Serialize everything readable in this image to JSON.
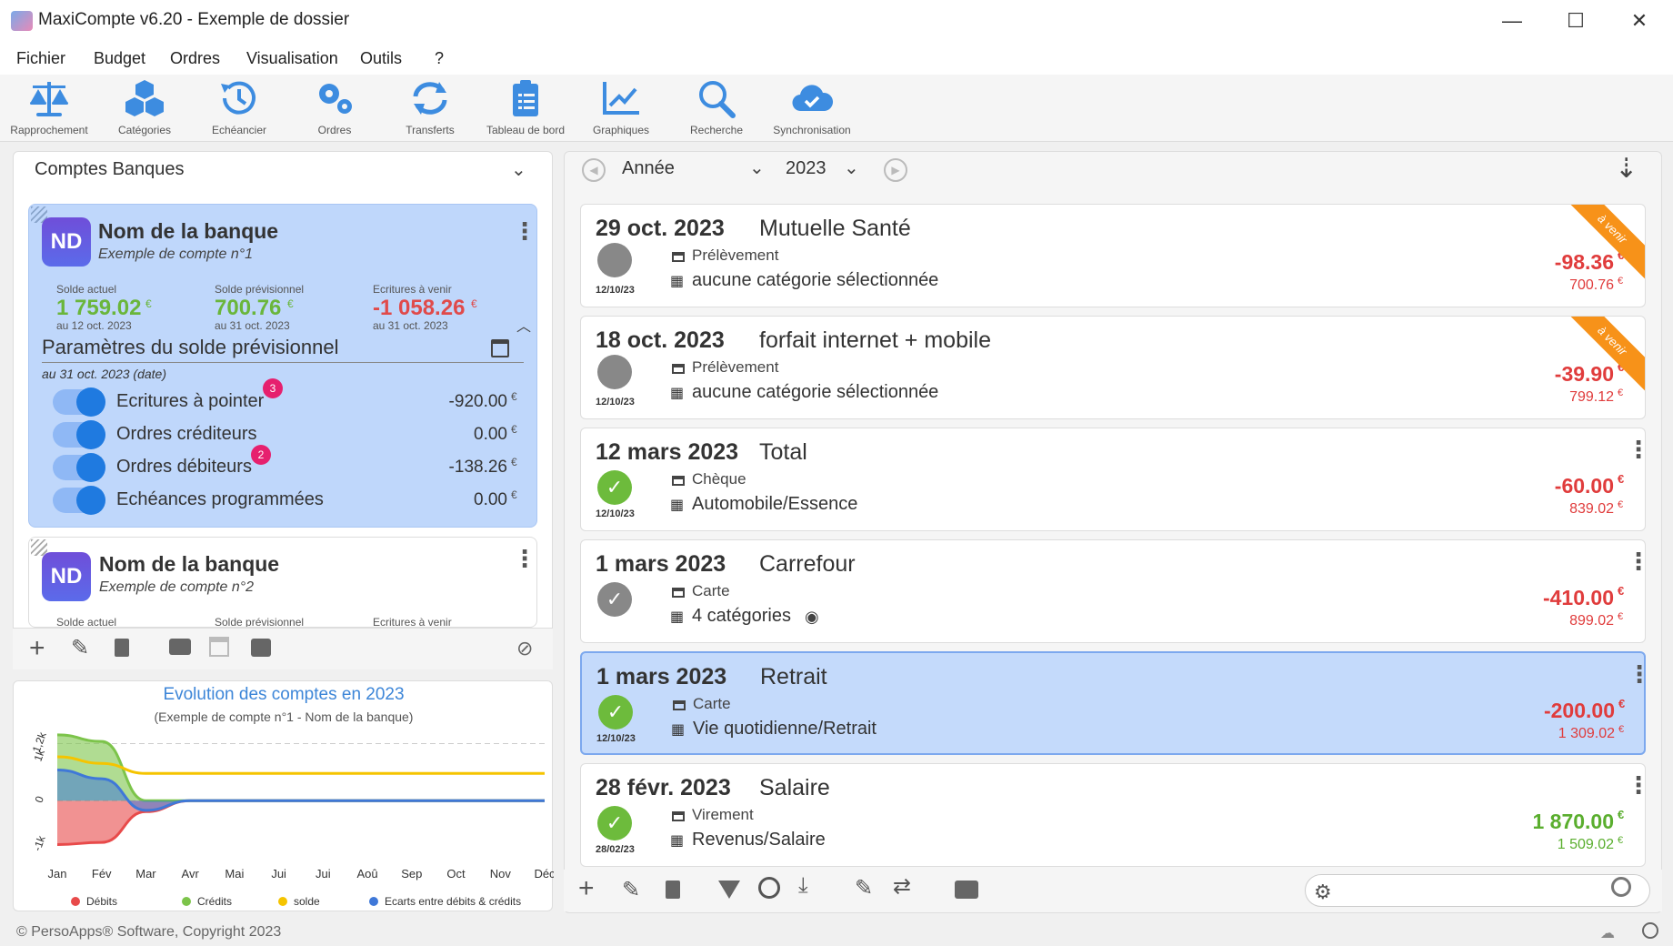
{
  "window": {
    "title": "MaxiCompte v6.20 - Exemple de dossier",
    "minimize": "—",
    "maximize": "☐",
    "close": "✕"
  },
  "menu": [
    "Fichier",
    "Budget",
    "Ordres",
    "Visualisation",
    "Outils",
    "?"
  ],
  "toolbar": [
    {
      "label": "Rapprochement",
      "icon": "scale-icon"
    },
    {
      "label": "Catégories",
      "icon": "cubes-icon"
    },
    {
      "label": "Echéancier",
      "icon": "history-icon"
    },
    {
      "label": "Ordres",
      "icon": "gears-icon"
    },
    {
      "label": "Transferts",
      "icon": "sync-icon"
    },
    {
      "label": "Tableau de bord",
      "icon": "clipboard-icon"
    },
    {
      "label": "Graphiques",
      "icon": "line-chart-icon"
    },
    {
      "label": "Recherche",
      "icon": "search-icon"
    },
    {
      "label": "Synchronisation",
      "icon": "cloud-check-icon"
    }
  ],
  "accounts": {
    "group": "Comptes Banques",
    "card1": {
      "initials": "ND",
      "bank": "Nom de la banque",
      "account": "Exemple de compte n°1",
      "current_label": "Solde actuel",
      "current_value": "1 759.02",
      "current_date": "au 12 oct. 2023",
      "forecast_label": "Solde prévisionnel",
      "forecast_value": "700.76",
      "forecast_date": "au 31 oct. 2023",
      "upcoming_label": "Ecritures à venir",
      "upcoming_value": "-1 058.26",
      "upcoming_date": "au 31 oct. 2023",
      "euro": "€",
      "params_title": "Paramètres du solde prévisionnel",
      "params_date": "au 31 oct. 2023 (date)",
      "toggles": [
        {
          "label": "Ecritures à pointer",
          "value": "-920.00",
          "badge": "3",
          "on": true
        },
        {
          "label": "Ordres créditeurs",
          "value": "0.00",
          "badge": "",
          "on": true
        },
        {
          "label": "Ordres débiteurs",
          "value": "-138.26",
          "badge": "2",
          "on": true
        },
        {
          "label": "Echéances programmées",
          "value": "0.00",
          "badge": "",
          "on": true
        }
      ]
    },
    "card2": {
      "initials": "ND",
      "bank": "Nom de la banque",
      "account": "Exemple de compte n°2",
      "current_label": "Solde actuel",
      "forecast_label": "Solde prévisionnel",
      "upcoming_label": "Ecritures à venir"
    }
  },
  "period": {
    "mode": "Année",
    "year": "2023"
  },
  "transactions": [
    {
      "date": "29 oct. 2023",
      "name": "Mutuelle Santé",
      "type": "Prélèvement",
      "category": "aucune catégorie sélectionnée",
      "amount": "-98.36",
      "balance": "700.76",
      "small_date": "12/10/23",
      "status": "pending",
      "ribbon": "à venir",
      "amount_color": "#e03c3c"
    },
    {
      "date": "18 oct. 2023",
      "name": "forfait internet + mobile",
      "type": "Prélèvement",
      "category": "aucune catégorie sélectionnée",
      "amount": "-39.90",
      "balance": "799.12",
      "small_date": "12/10/23",
      "status": "pending",
      "ribbon": "à venir",
      "amount_color": "#e03c3c"
    },
    {
      "date": "12 mars 2023",
      "name": "Total",
      "type": "Chèque",
      "category": "Automobile/Essence",
      "amount": "-60.00",
      "balance": "839.02",
      "small_date": "12/10/23",
      "status": "checked",
      "ribbon": "",
      "amount_color": "#e03c3c"
    },
    {
      "date": "1 mars 2023",
      "name": "Carrefour",
      "type": "Carte",
      "category": "4 catégories",
      "amount": "-410.00",
      "balance": "899.02",
      "small_date": "",
      "status": "reconciled",
      "ribbon": "",
      "amount_color": "#e03c3c"
    },
    {
      "date": "1 mars 2023",
      "name": "Retrait",
      "type": "Carte",
      "category": "Vie quotidienne/Retrait",
      "amount": "-200.00",
      "balance": "1 309.02",
      "small_date": "12/10/23",
      "status": "checked",
      "ribbon": "",
      "amount_color": "#e03c3c"
    },
    {
      "date": "28 févr. 2023",
      "name": "Salaire",
      "type": "Virement",
      "category": "Revenus/Salaire",
      "amount": "1 870.00",
      "balance": "1 509.02",
      "small_date": "28/02/23",
      "status": "checked",
      "ribbon": "",
      "amount_color": "#5aae2e"
    }
  ],
  "chart_data": {
    "type": "area",
    "title": "Evolution des comptes en 2023",
    "subtitle": "(Exemple de compte n°1 - Nom de la banque)",
    "categories": [
      "Jan",
      "Fév",
      "Mar",
      "Avr",
      "Mai",
      "Jui",
      "Jui",
      "Aoû",
      "Sep",
      "Oct",
      "Nov",
      "Déc"
    ],
    "y_ticks": [
      "1,2k",
      "1k",
      "0",
      "-1k"
    ],
    "series": [
      {
        "name": "Débits",
        "color": "#e84a4a",
        "values": [
          -1000,
          -950,
          -250,
          0,
          0,
          0,
          0,
          0,
          0,
          0,
          0,
          0
        ]
      },
      {
        "name": "Crédits",
        "color": "#7cc44a",
        "values": [
          1500,
          1350,
          0,
          0,
          0,
          0,
          0,
          0,
          0,
          0,
          0,
          0
        ]
      },
      {
        "name": "solde",
        "color": "#f5c400",
        "values": [
          1000,
          850,
          620,
          620,
          620,
          620,
          620,
          620,
          620,
          620,
          620,
          620
        ]
      },
      {
        "name": "Ecarts entre débits & crédits",
        "color": "#3f78d8",
        "values": [
          700,
          500,
          -220,
          0,
          0,
          0,
          0,
          0,
          0,
          0,
          0,
          0
        ]
      }
    ]
  },
  "search": {
    "placeholder": ""
  },
  "footer": {
    "copyright": "© PersoApps® Software, Copyright 2023"
  }
}
